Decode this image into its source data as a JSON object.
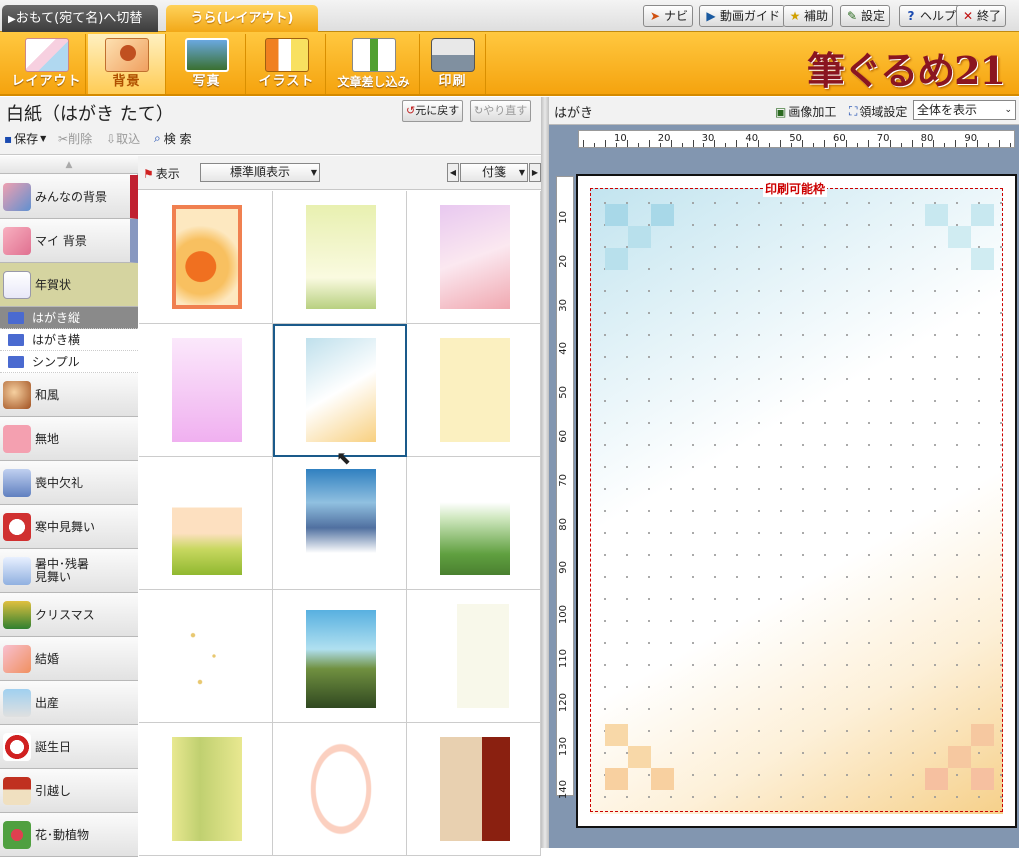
{
  "tabs": {
    "omote": "おもて(宛て名)へ切替",
    "ura": "うら(レイアウト)"
  },
  "topbuttons": [
    {
      "label": "ナビ",
      "icon": "navi-icon",
      "color": "#d05010",
      "glyph": "➤"
    },
    {
      "label": "動画ガイド",
      "icon": "video-guide-icon",
      "color": "#1a5aa0",
      "glyph": "▶"
    },
    {
      "label": "補助",
      "icon": "star-icon",
      "color": "#d0a000",
      "glyph": "★"
    },
    {
      "label": "設定",
      "icon": "wrench-icon",
      "color": "#2a6a20",
      "glyph": "✎"
    },
    {
      "label": "ヘルプ",
      "icon": "help-icon",
      "color": "#1a4ab0",
      "glyph": "?"
    },
    {
      "label": "終了",
      "icon": "exit-icon",
      "color": "#c01010",
      "glyph": "✕"
    }
  ],
  "tools": [
    {
      "label": "レイアウト",
      "icon": "layout-icon"
    },
    {
      "label": "背景",
      "icon": "background-icon"
    },
    {
      "label": "写真",
      "icon": "photo-icon"
    },
    {
      "label": "イラスト",
      "icon": "illust-icon"
    },
    {
      "label": "文章差し込み",
      "icon": "text-insert-icon"
    },
    {
      "label": "印刷",
      "icon": "printer-icon"
    }
  ],
  "logo": "筆ぐるめ21",
  "doc_title": "白紙（はがき たて）",
  "undo_label": "元に戻す",
  "redo_label": "やり直す",
  "actions": {
    "save": "保存",
    "delete": "削除",
    "import": "取込",
    "search": "検 索"
  },
  "categories": [
    {
      "label": "みんなの背景"
    },
    {
      "label": "マイ 背景"
    },
    {
      "label": "年賀状"
    },
    {
      "label": "和風"
    },
    {
      "label": "無地"
    },
    {
      "label": "喪中欠礼"
    },
    {
      "label": "寒中見舞い"
    },
    {
      "label": "暑中･残暑\n見舞い"
    },
    {
      "label": "クリスマス"
    },
    {
      "label": "結婚"
    },
    {
      "label": "出産"
    },
    {
      "label": "誕生日"
    },
    {
      "label": "引越し"
    },
    {
      "label": "花･動植物"
    }
  ],
  "subcategories": [
    "はがき縦",
    "はがき横",
    "シンプル"
  ],
  "filter": {
    "display_label": "表示",
    "sort_value": "標準順表示",
    "tag_value": "付箋"
  },
  "right": {
    "title": "はがき",
    "image_edit": "画像加工",
    "area_setting": "領域設定",
    "view_value": "全体を表示"
  },
  "print_frame_label": "印刷可能枠",
  "ruler_h": [
    "10",
    "20",
    "30",
    "40",
    "50",
    "60",
    "70",
    "80",
    "90"
  ],
  "ruler_v": [
    "10",
    "20",
    "30",
    "40",
    "50",
    "60",
    "70",
    "80",
    "90",
    "100",
    "110",
    "120",
    "130",
    "140"
  ],
  "colors": {
    "orange": "#f5a30e",
    "brand": "#8a1520",
    "selection": "#1a5a8a",
    "print_frame": "#cc0000"
  }
}
